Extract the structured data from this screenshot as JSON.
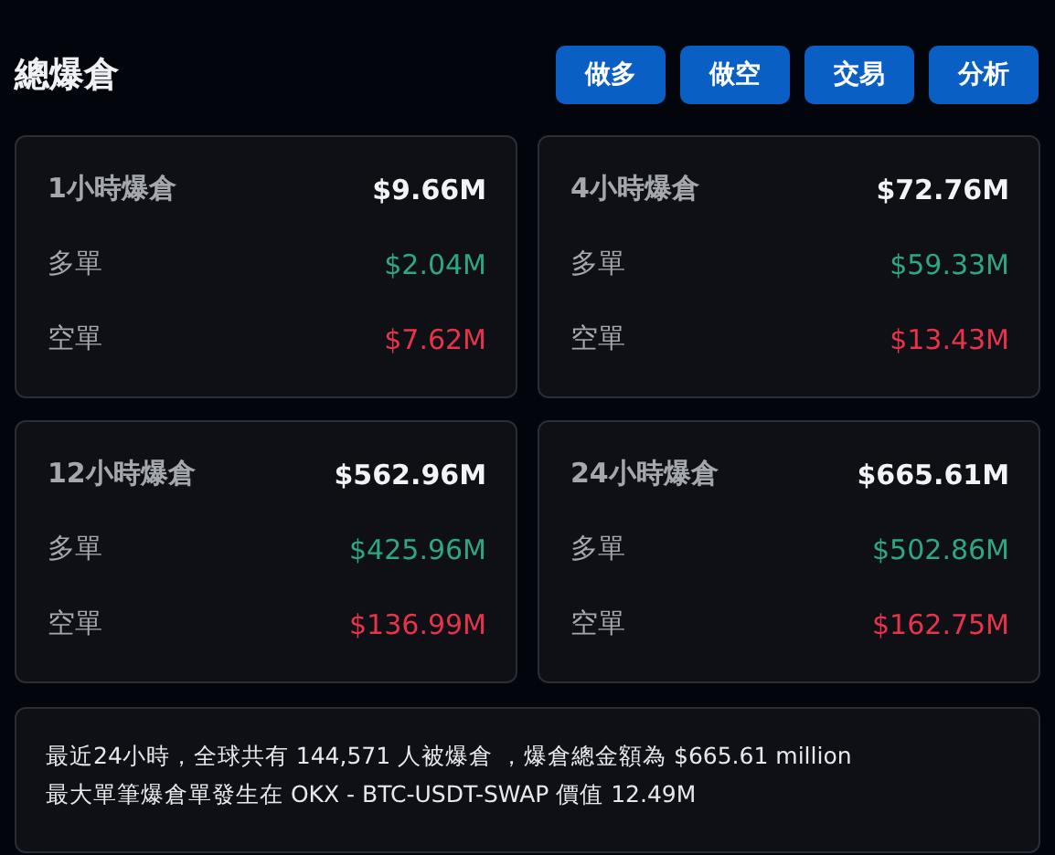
{
  "title": "總爆倉",
  "buttons": [
    "做多",
    "做空",
    "交易",
    "分析"
  ],
  "cards": [
    {
      "rows": [
        {
          "kind": "total",
          "label": "1小時爆倉",
          "value": "$9.66M"
        },
        {
          "kind": "long",
          "label": "多單",
          "value": "$2.04M"
        },
        {
          "kind": "short",
          "label": "空單",
          "value": "$7.62M"
        }
      ]
    },
    {
      "rows": [
        {
          "kind": "total",
          "label": "4小時爆倉",
          "value": "$72.76M"
        },
        {
          "kind": "long",
          "label": "多單",
          "value": "$59.33M"
        },
        {
          "kind": "short",
          "label": "空單",
          "value": "$13.43M"
        }
      ]
    },
    {
      "rows": [
        {
          "kind": "total",
          "label": "12小時爆倉",
          "value": "$562.96M"
        },
        {
          "kind": "long",
          "label": "多單",
          "value": "$425.96M"
        },
        {
          "kind": "short",
          "label": "空單",
          "value": "$136.99M"
        }
      ]
    },
    {
      "rows": [
        {
          "kind": "total",
          "label": "24小時爆倉",
          "value": "$665.61M"
        },
        {
          "kind": "long",
          "label": "多單",
          "value": "$502.86M"
        },
        {
          "kind": "short",
          "label": "空單",
          "value": "$162.75M"
        }
      ]
    }
  ],
  "summary": [
    "最近24小時，全球共有 144,571 人被爆倉 ，爆倉總金額為 $665.61 million",
    "最大單筆爆倉單發生在 OKX - BTC-USDT-SWAP 價值 12.49M"
  ]
}
